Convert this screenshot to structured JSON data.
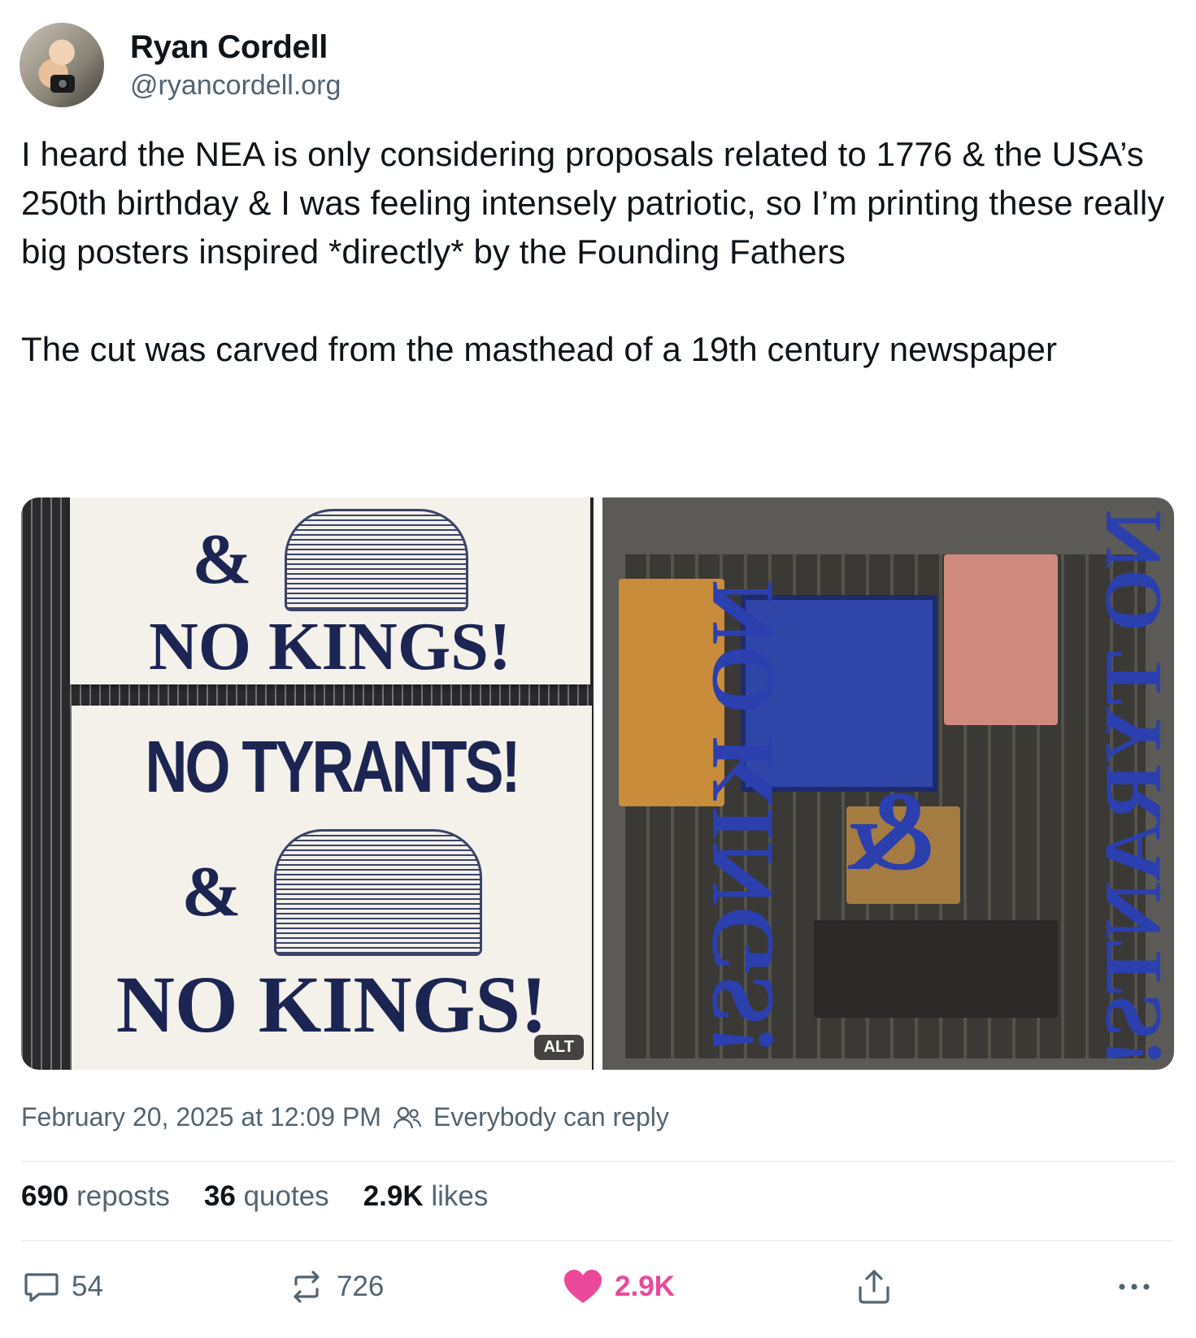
{
  "author": {
    "name": "Ryan Cordell",
    "handle": "@ryancordell.org"
  },
  "post": {
    "text": "I heard the NEA is only considering proposals related to 1776 & the USA’s 250th birthday & I was feeling intensely patriotic, so I’m printing these really big posters inspired *directly* by the Founding Fathers\n\nThe cut was carved from the masthead of a 19th century newspaper",
    "images": {
      "left": {
        "poster_top": {
          "line1": "&",
          "line2": "NO KINGS!"
        },
        "poster_bottom": {
          "line1": "NO TYRANTS!",
          "line2": "&",
          "line3": "NO KINGS!"
        },
        "alt_label": "ALT"
      },
      "right": {
        "type_left": "NO KINGS!",
        "type_mid": "&",
        "type_right": "NO TYRANTS!"
      }
    },
    "timestamp": "February 20, 2025 at 12:09 PM",
    "reply_setting": "Everybody can reply"
  },
  "stats": {
    "reposts_count": "690",
    "reposts_label": "reposts",
    "quotes_count": "36",
    "quotes_label": "quotes",
    "likes_count": "2.9K",
    "likes_label": "likes"
  },
  "actions": {
    "replies": "54",
    "reposts": "726",
    "likes": "2.9K",
    "icons": [
      "reply-icon",
      "repost-icon",
      "heart-icon",
      "share-icon",
      "more-icon"
    ]
  },
  "colors": {
    "like_pink": "#ec4899",
    "muted_text": "#536471",
    "ink_blue": "#1c2552"
  }
}
